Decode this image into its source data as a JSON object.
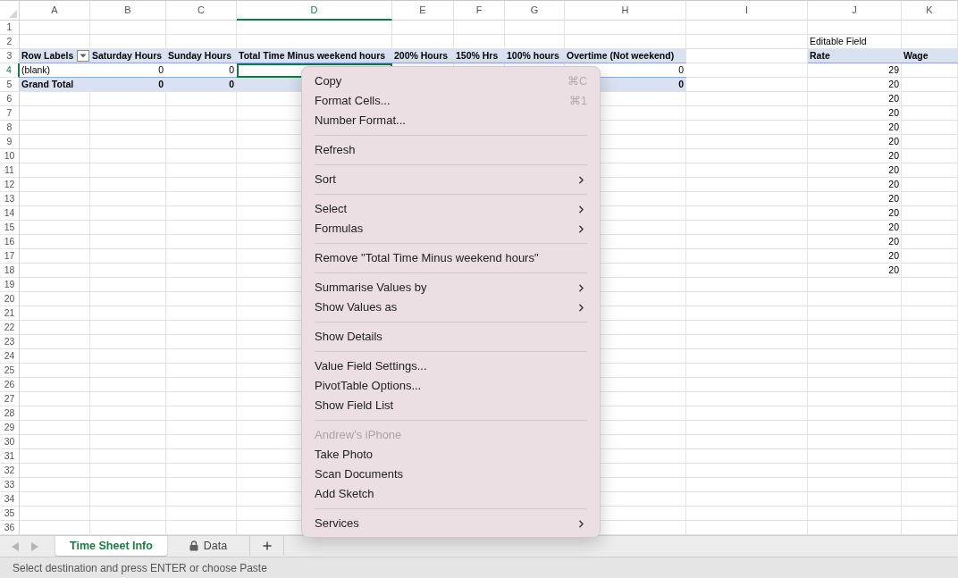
{
  "sheet": {
    "columns": [
      {
        "label": "A",
        "selected": false
      },
      {
        "label": "B",
        "selected": false
      },
      {
        "label": "C",
        "selected": false
      },
      {
        "label": "D",
        "selected": true
      },
      {
        "label": "E",
        "selected": false
      },
      {
        "label": "F",
        "selected": false
      },
      {
        "label": "G",
        "selected": false
      },
      {
        "label": "H",
        "selected": false
      },
      {
        "label": "I",
        "selected": false
      },
      {
        "label": "J",
        "selected": false
      },
      {
        "label": "K",
        "selected": false
      }
    ],
    "rows": [
      {
        "label": "1",
        "selected": false
      },
      {
        "label": "2",
        "selected": false
      },
      {
        "label": "3",
        "selected": false
      },
      {
        "label": "4",
        "selected": true
      },
      {
        "label": "5",
        "selected": false
      },
      {
        "label": "6",
        "selected": false
      },
      {
        "label": "7",
        "selected": false
      },
      {
        "label": "8",
        "selected": false
      },
      {
        "label": "9",
        "selected": false
      },
      {
        "label": "10",
        "selected": false
      },
      {
        "label": "11",
        "selected": false
      },
      {
        "label": "12",
        "selected": false
      },
      {
        "label": "13",
        "selected": false
      },
      {
        "label": "14",
        "selected": false
      },
      {
        "label": "15",
        "selected": false
      },
      {
        "label": "16",
        "selected": false
      },
      {
        "label": "17",
        "selected": false
      },
      {
        "label": "18",
        "selected": false
      },
      {
        "label": "19",
        "selected": false
      },
      {
        "label": "20",
        "selected": false
      },
      {
        "label": "21",
        "selected": false
      },
      {
        "label": "22",
        "selected": false
      },
      {
        "label": "23",
        "selected": false
      },
      {
        "label": "24",
        "selected": false
      },
      {
        "label": "25",
        "selected": false
      },
      {
        "label": "26",
        "selected": false
      },
      {
        "label": "27",
        "selected": false
      },
      {
        "label": "28",
        "selected": false
      },
      {
        "label": "29",
        "selected": false
      },
      {
        "label": "30",
        "selected": false
      },
      {
        "label": "31",
        "selected": false
      },
      {
        "label": "32",
        "selected": false
      },
      {
        "label": "33",
        "selected": false
      },
      {
        "label": "34",
        "selected": false
      },
      {
        "label": "35",
        "selected": false
      },
      {
        "label": "36",
        "selected": false
      }
    ],
    "pivot_table": {
      "columns": [
        {
          "label": "Row Labels"
        },
        {
          "label": "Saturday Hours",
          "values": [
            "0",
            "0"
          ]
        },
        {
          "label": "Sunday Hours",
          "values": [
            "0",
            "0"
          ]
        },
        {
          "label": "Total Time Minus weekend hours"
        },
        {
          "label": "200% Hours"
        },
        {
          "label": "150% Hrs"
        },
        {
          "label": "100% hours"
        },
        {
          "label": "Overtime (Not weekend)",
          "values": [
            "0",
            "0"
          ]
        }
      ],
      "rows": [
        {
          "kind": "row",
          "label": "(blank)"
        },
        {
          "kind": "total",
          "label": "Grand Total"
        }
      ]
    },
    "rate_table": {
      "note": "Editable Field",
      "columns": [
        "Rate",
        "Wage"
      ],
      "rates": [
        "29",
        "20",
        "20",
        "20",
        "20",
        "20",
        "20",
        "20",
        "20",
        "20",
        "20",
        "20",
        "20",
        "20",
        "20"
      ]
    }
  },
  "context_menu": {
    "sections": [
      {
        "items": [
          {
            "label": "Copy",
            "shortcut": "⌘C",
            "submenu": false,
            "disabled": false
          },
          {
            "label": "Format Cells...",
            "shortcut": "⌘1",
            "submenu": false,
            "disabled": false
          },
          {
            "label": "Number Format...",
            "submenu": false,
            "disabled": false
          }
        ]
      },
      {
        "items": [
          {
            "label": "Refresh",
            "submenu": false,
            "disabled": false
          }
        ]
      },
      {
        "items": [
          {
            "label": "Sort",
            "submenu": true,
            "disabled": false
          }
        ]
      },
      {
        "items": [
          {
            "label": "Select",
            "submenu": true,
            "disabled": false
          },
          {
            "label": "Formulas",
            "submenu": true,
            "disabled": false
          }
        ]
      },
      {
        "items": [
          {
            "label": "Remove \"Total Time Minus weekend hours\"",
            "submenu": false,
            "disabled": false
          }
        ]
      },
      {
        "items": [
          {
            "label": "Summarise Values by",
            "submenu": true,
            "disabled": false
          },
          {
            "label": "Show Values as",
            "submenu": true,
            "disabled": false
          }
        ]
      },
      {
        "items": [
          {
            "label": "Show Details",
            "submenu": false,
            "disabled": false
          }
        ]
      },
      {
        "items": [
          {
            "label": "Value Field Settings...",
            "submenu": false,
            "disabled": false
          },
          {
            "label": "PivotTable Options...",
            "submenu": false,
            "disabled": false
          },
          {
            "label": "Show Field List",
            "submenu": false,
            "disabled": false
          }
        ]
      },
      {
        "items": [
          {
            "label": "Andrew’s iPhone",
            "submenu": false,
            "disabled": true
          },
          {
            "label": "Take Photo",
            "submenu": false,
            "disabled": false
          },
          {
            "label": "Scan Documents",
            "submenu": false,
            "disabled": false
          },
          {
            "label": "Add Sketch",
            "submenu": false,
            "disabled": false
          }
        ]
      },
      {
        "items": [
          {
            "label": "Services",
            "submenu": true,
            "disabled": false
          }
        ]
      }
    ]
  },
  "sheet_tabs": [
    {
      "label": "Time Sheet Info",
      "selected": true,
      "locked": false
    },
    {
      "label": "Data",
      "selected": false,
      "locked": true
    }
  ],
  "status_bar": {
    "text": "Select destination and press ENTER or choose Paste"
  }
}
